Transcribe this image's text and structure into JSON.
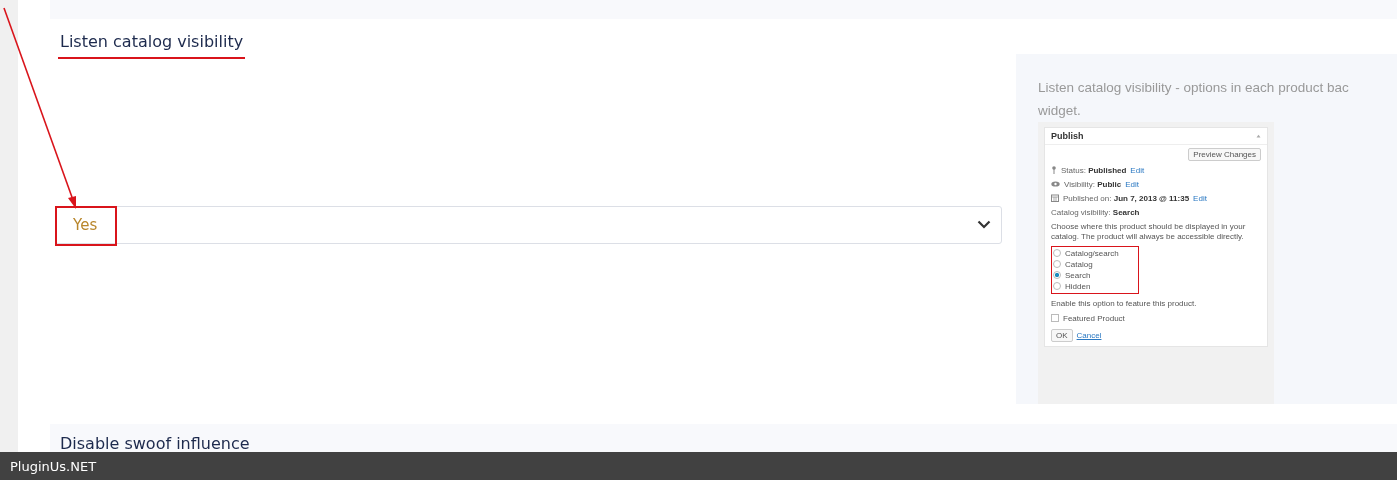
{
  "setting": {
    "title": "Listen catalog visibility",
    "select": {
      "value": "Yes"
    },
    "help_lines": [
      "Listen catalog visibility - options in each product bac",
      "widget."
    ]
  },
  "screenshot": {
    "title": "Publish",
    "preview_button": "Preview Changes",
    "meta": [
      {
        "kind": "pin",
        "label": "Status:",
        "value": "Published",
        "link": "Edit"
      },
      {
        "kind": "eye",
        "label": "Visibility:",
        "value": "Public",
        "link": "Edit"
      },
      {
        "kind": "calendar",
        "label": "Published on:",
        "value": "Jun 7, 2013 @ 11:35",
        "link": "Edit"
      }
    ],
    "catalog_visibility": {
      "label": "Catalog visibility:",
      "value": "Search"
    },
    "description": "Choose where this product should be displayed in your catalog. The product will always be accessible directly.",
    "options": [
      {
        "label": "Catalog/search",
        "selected": false
      },
      {
        "label": "Catalog",
        "selected": false
      },
      {
        "label": "Search",
        "selected": true
      },
      {
        "label": "Hidden",
        "selected": false
      }
    ],
    "feature_hint": "Enable this option to feature this product.",
    "featured": {
      "label": "Featured Product",
      "checked": false
    },
    "ok": "OK",
    "cancel": "Cancel"
  },
  "next_section": {
    "title": "Disable swoof influence"
  },
  "footer": {
    "brand": "PluginUs.NET"
  }
}
